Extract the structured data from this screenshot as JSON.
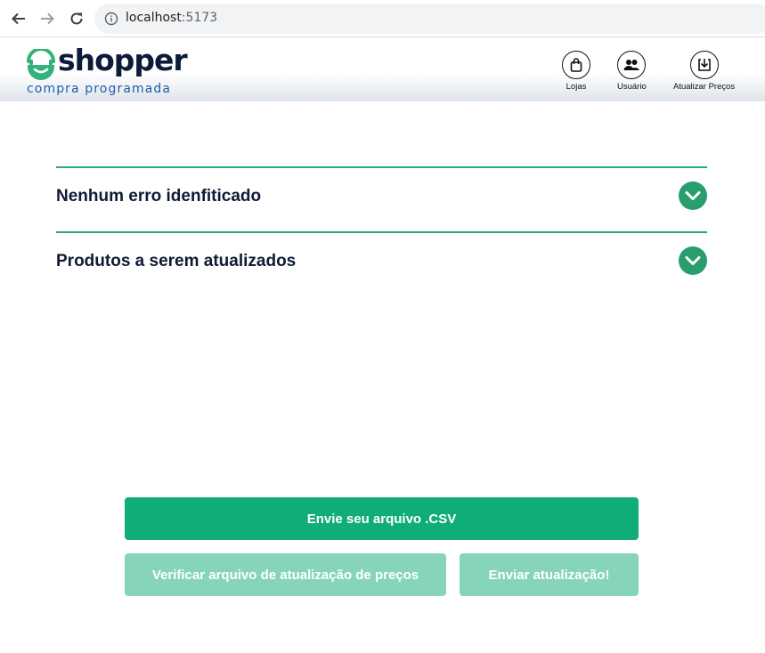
{
  "browser": {
    "url_host": "localhost",
    "url_port": ":5173"
  },
  "header": {
    "logo_word": "shopper",
    "logo_tagline": "compra programada",
    "nav": [
      {
        "label": "Lojas",
        "icon": "shopping-bag-icon"
      },
      {
        "label": "Usuário",
        "icon": "users-icon"
      },
      {
        "label": "Atualizar Preços",
        "icon": "download-icon"
      }
    ]
  },
  "accordion": [
    {
      "title": "Nenhum erro idenfiticado",
      "icon": "chevron-down-icon"
    },
    {
      "title": "Produtos a serem atualizados",
      "icon": "chevron-down-icon"
    }
  ],
  "actions": {
    "upload_label": "Envie seu arquivo .CSV",
    "verify_label": "Verificar arquivo de atualização de preços",
    "send_label": "Enviar atualização!"
  },
  "colors": {
    "brand_green": "#10ad78",
    "disabled_green": "#86d5b8",
    "accent_line": "#2ea67a",
    "navy": "#0d1a3a",
    "tagline_blue": "#1f5fa8"
  }
}
